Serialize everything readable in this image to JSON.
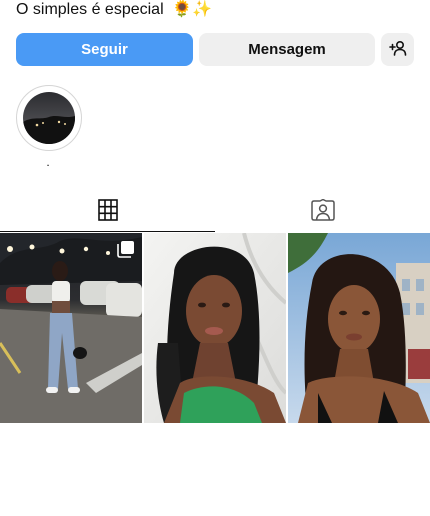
{
  "bio": {
    "text": "O simples é especial",
    "emojis": "🌻✨"
  },
  "actions": {
    "follow_label": "Seguir",
    "message_label": "Mensagem",
    "add_user_icon": "add-user-icon"
  },
  "highlights": [
    {
      "label": "."
    }
  ],
  "tabs": [
    {
      "icon": "grid-icon",
      "active": true
    },
    {
      "icon": "tagged-person-icon",
      "active": false
    }
  ],
  "posts": [
    {
      "type": "photo-carousel",
      "icon": "multiple-photos-icon"
    },
    {
      "type": "photo"
    },
    {
      "type": "photo"
    }
  ],
  "colors": {
    "accent": "#4a9af5",
    "secondary_button": "#efefef"
  }
}
